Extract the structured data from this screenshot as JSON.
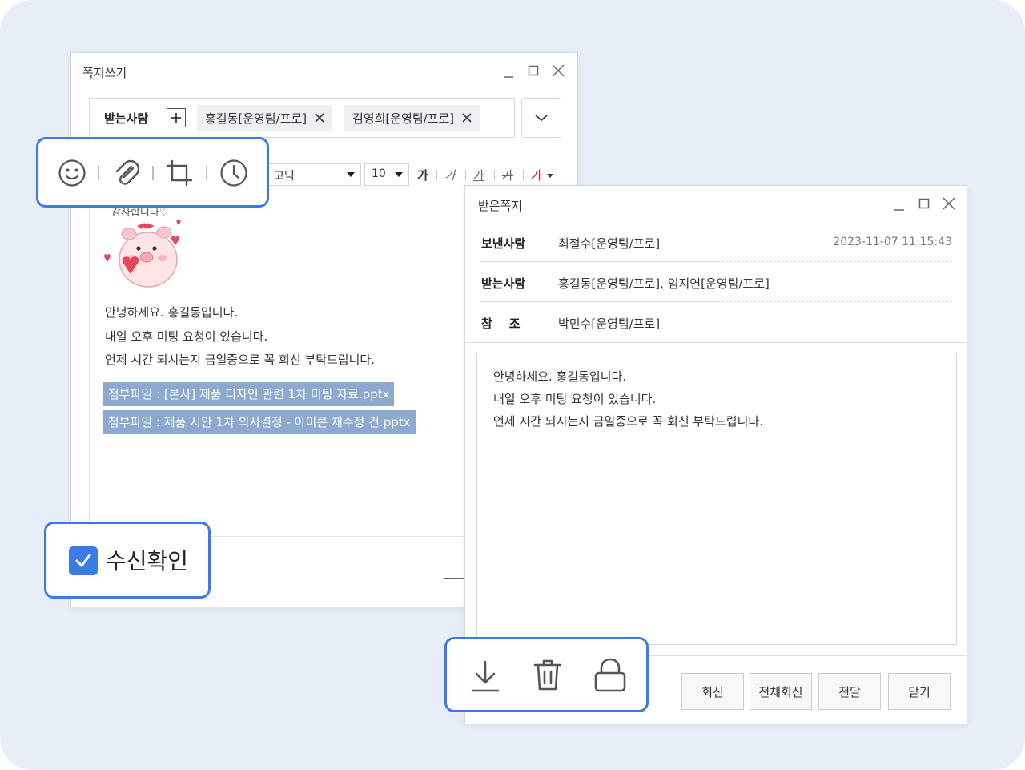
{
  "compose": {
    "title": "쪽지쓰기",
    "recipients_label": "받는사람",
    "recipients": [
      "홍길동[운영팀/프로]",
      "김영희[운영팀/프로]"
    ],
    "font_family": "고딕",
    "font_size": "10",
    "format_buttons": [
      "가",
      "가",
      "가",
      "가",
      "가"
    ],
    "sticker_caption": "감사합니다♡",
    "body_lines": [
      "안녕하세요. 홍길동입니다.",
      "내일 오후 미팅 요청이 있습니다.",
      "언제 시간 되시는지 금일중으로 꼭 회신 부탁드립니다."
    ],
    "attachments": [
      "첨부파일 : [본사] 제품 디자인 관련 1차 미팅 자료.pptx",
      "첨부파일 : 제품 시안 1차 의사결정 - 아이콘 재수정 건.pptx"
    ],
    "read_receipt_label": "수신확인",
    "read_receipt_checked": true
  },
  "received": {
    "title": "받은쪽지",
    "sender_label": "보낸사람",
    "sender": "최철수[운영팀/프로]",
    "date": "2023-11-07 11:15:43",
    "recipients_label": "받는사람",
    "recipients": "홍길동[운영팀/프로], 임지연[운영팀/프로]",
    "cc_label": "참    조",
    "cc": "박민수[운영팀/프로]",
    "body_lines": [
      "안녕하세요. 홍길동입니다.",
      "내일 오후 미팅 요청이 있습니다.",
      "언제 시간 되시는지 금일중으로 꼭 회신 부탁드립니다."
    ],
    "buttons": {
      "reply": "회신",
      "reply_all": "전체회신",
      "forward": "전달",
      "close": "닫기"
    }
  },
  "colors": {
    "accent": "#3b7be8",
    "attachment_bg": "#8ea9cf",
    "format_red": "#e02020"
  }
}
